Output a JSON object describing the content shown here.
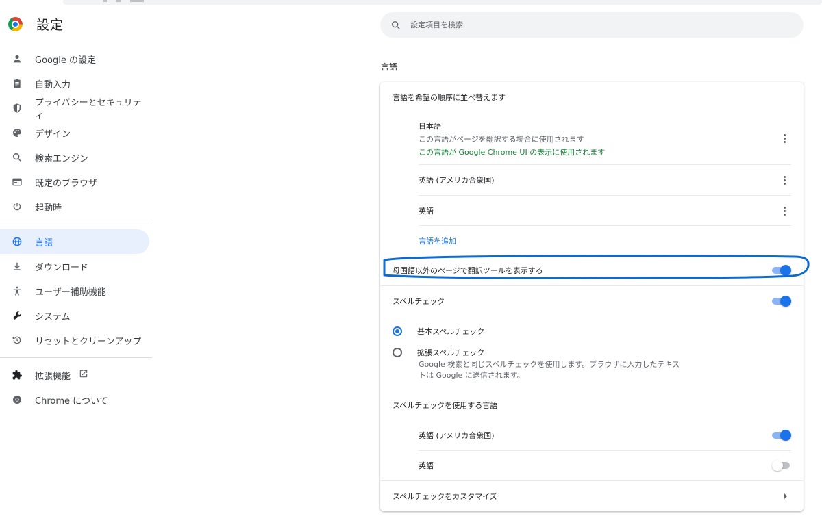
{
  "brand": {
    "title": "設定"
  },
  "search": {
    "placeholder": "設定項目を検索"
  },
  "nav": {
    "items": [
      {
        "label": "Google の設定",
        "icon": "person-icon"
      },
      {
        "label": "自動入力",
        "icon": "clipboard-icon"
      },
      {
        "label": "プライバシーとセキュリティ",
        "icon": "shield-icon"
      },
      {
        "label": "デザイン",
        "icon": "palette-icon"
      },
      {
        "label": "検索エンジン",
        "icon": "search-icon"
      },
      {
        "label": "既定のブラウザ",
        "icon": "browser-icon"
      },
      {
        "label": "起動時",
        "icon": "power-icon"
      },
      {
        "label": "言語",
        "icon": "globe-icon",
        "active": true
      },
      {
        "label": "ダウンロード",
        "icon": "download-icon"
      },
      {
        "label": "ユーザー補助機能",
        "icon": "accessibility-icon"
      },
      {
        "label": "システム",
        "icon": "wrench-icon"
      },
      {
        "label": "リセットとクリーンアップ",
        "icon": "restore-icon"
      },
      {
        "label": "拡張機能",
        "icon": "puzzle-icon"
      },
      {
        "label": "Chrome について",
        "icon": "chrome-icon"
      }
    ]
  },
  "section": {
    "title": "言語"
  },
  "languages": {
    "order_label": "言語を希望の順序に並べ替えます",
    "list": [
      {
        "name": "日本語",
        "desc1": "この言語がページを翻訳する場合に使用されます",
        "desc2": "この言語が Google Chrome UI の表示に使用されます"
      },
      {
        "name": "英語 (アメリカ合衆国)"
      },
      {
        "name": "英語"
      }
    ],
    "add_label": "言語を追加",
    "translate_label": "母国語以外のページで翻訳ツールを表示する",
    "translate_on": true
  },
  "spellcheck": {
    "label": "スペルチェック",
    "on": true,
    "basic_label": "基本スペルチェック",
    "enhanced_label": "拡張スペルチェック",
    "enhanced_desc1": "Google 検索と同じスペルチェックを使用します。ブラウザに入力したテキス",
    "enhanced_desc2": "トは Google に送信されます。",
    "languages_label": "スペルチェックを使用する言語",
    "lang_items": [
      {
        "name": "英語 (アメリカ合衆国)",
        "on": true
      },
      {
        "name": "英語",
        "on": false
      }
    ],
    "customize_label": "スペルチェックをカスタマイズ"
  },
  "colors": {
    "accent": "#1a73e8",
    "annotation": "#0b6bcf",
    "active_bg": "#e8f0fe"
  }
}
